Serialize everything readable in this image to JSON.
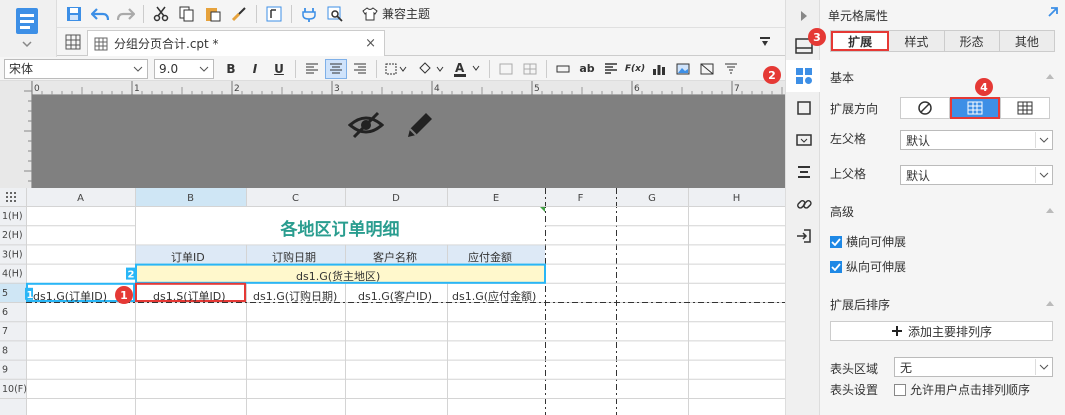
{
  "toolbar": {
    "theme_label": "兼容主题"
  },
  "tab": {
    "title": "分组分页合计.cpt *",
    "close": "×"
  },
  "format": {
    "font_name": "宋体",
    "font_size": "9.0",
    "bold": "B",
    "italic": "I",
    "underline": "U",
    "ab_label": "ab",
    "fx_label": "F(x)"
  },
  "ruler": {
    "ticks": [
      "0",
      "1",
      "2",
      "3",
      "4",
      "5",
      "6",
      "7"
    ]
  },
  "grid": {
    "columns": [
      "A",
      "B",
      "C",
      "D",
      "E",
      "F",
      "G",
      "H"
    ],
    "rows": [
      "1(H)",
      "2(H)",
      "3(H)",
      "4(H)",
      "5",
      "6",
      "7",
      "8",
      "9",
      "10(F)"
    ],
    "title": "各地区订单明细",
    "headers": [
      "订单ID",
      "订购日期",
      "客户名称",
      "应付金额"
    ],
    "group_cell": "ds1.G(货主地区)",
    "row5": [
      "ds1.G(订单ID)",
      "ds1.S(订单ID)",
      "ds1.G(订购日期)",
      "ds1.G(客户ID)",
      "ds1.G(应付金额)"
    ],
    "badge1": "1",
    "badge_a5": "1",
    "badge_b4": "2"
  },
  "panel": {
    "title": "单元格属性",
    "tabs": [
      "扩展",
      "样式",
      "形态",
      "其他"
    ],
    "section_basic": "基本",
    "expand_direction": "扩展方向",
    "left_parent": "左父格",
    "left_parent_value": "默认",
    "top_parent": "上父格",
    "top_parent_value": "默认",
    "section_advanced": "高级",
    "h_extend": "横向可伸展",
    "v_extend": "纵向可伸展",
    "section_sort": "扩展后排序",
    "add_sort": "添加主要排列序",
    "header_area": "表头区域",
    "header_area_value": "无",
    "header_settings": "表头设置",
    "allow_user_sort": "允许用户点击排列顺序"
  },
  "annotations": {
    "badge2": "2",
    "badge3": "3",
    "badge4": "4"
  }
}
